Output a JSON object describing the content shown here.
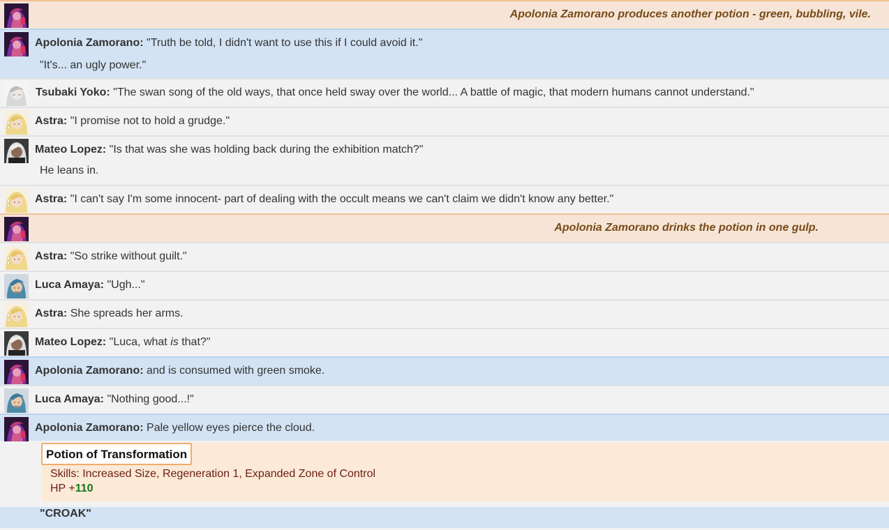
{
  "messages": [
    {
      "type": "emote",
      "speaker": "Apolonia Zamorano",
      "text": "Apolonia Zamorano produces another potion - green, bubbling, vile."
    },
    {
      "type": "say",
      "speaker": "Apolonia Zamorano",
      "text": "\"Truth be told, I didn't want to use this if I could avoid it.\"",
      "extra": "\"It's... an ugly power.\""
    },
    {
      "type": "say",
      "speaker": "Tsubaki Yoko",
      "text": "\"The swan song of the old ways, that once held sway over the world... A battle of magic, that modern humans cannot understand.\""
    },
    {
      "type": "say",
      "speaker": "Astra",
      "text": "\"I promise not to hold a grudge.\""
    },
    {
      "type": "say",
      "speaker": "Mateo Lopez",
      "text": "\"Is that was she was holding back during the exhibition match?\"",
      "extra": "He leans in."
    },
    {
      "type": "say",
      "speaker": "Astra",
      "text": "\"I can't say I'm some innocent- part of dealing with the occult means we can't claim we didn't know any better.\""
    },
    {
      "type": "emote",
      "speaker": "Apolonia Zamorano",
      "text": "Apolonia Zamorano drinks the potion in one gulp."
    },
    {
      "type": "say",
      "speaker": "Astra",
      "text": "\"So strike without guilt.\""
    },
    {
      "type": "say",
      "speaker": "Luca Amaya",
      "text": "\"Ugh...\""
    },
    {
      "type": "say",
      "speaker": "Astra",
      "text": "She spreads her arms."
    },
    {
      "type": "say",
      "speaker": "Mateo Lopez",
      "text_before": "\"Luca, what ",
      "text_em": "is",
      "text_after": " that?\""
    },
    {
      "type": "say",
      "speaker": "Apolonia Zamorano",
      "text": "and is consumed with green smoke."
    },
    {
      "type": "say",
      "speaker": "Luca Amaya",
      "text": "\"Nothing good...!\""
    },
    {
      "type": "say",
      "speaker": "Apolonia Zamorano",
      "text": "Pale yellow eyes pierce the cloud."
    }
  ],
  "card": {
    "title": "Potion of Transformation",
    "skills": "Skills: Increased Size, Regeneration 1, Expanded Zone of Control",
    "hp_label": "HP +",
    "hp_value": "110"
  },
  "final_text": "\"CROAK\"",
  "colors": {
    "say_bg": "#f2f2f2",
    "blue_bg": "#d3e3f4",
    "emote_bg": "#f6e5d7",
    "emote_text": "#774b17",
    "card_bg": "#fce9d7",
    "card_border": "#f0ad6a",
    "skills_text": "#6b1e14",
    "hp_value": "#17751a"
  },
  "avatars": {
    "apolonia": "apolonia-avatar",
    "tsubaki": "tsubaki-avatar",
    "astra": "astra-avatar",
    "mateo": "mateo-avatar",
    "luca": "luca-avatar"
  }
}
